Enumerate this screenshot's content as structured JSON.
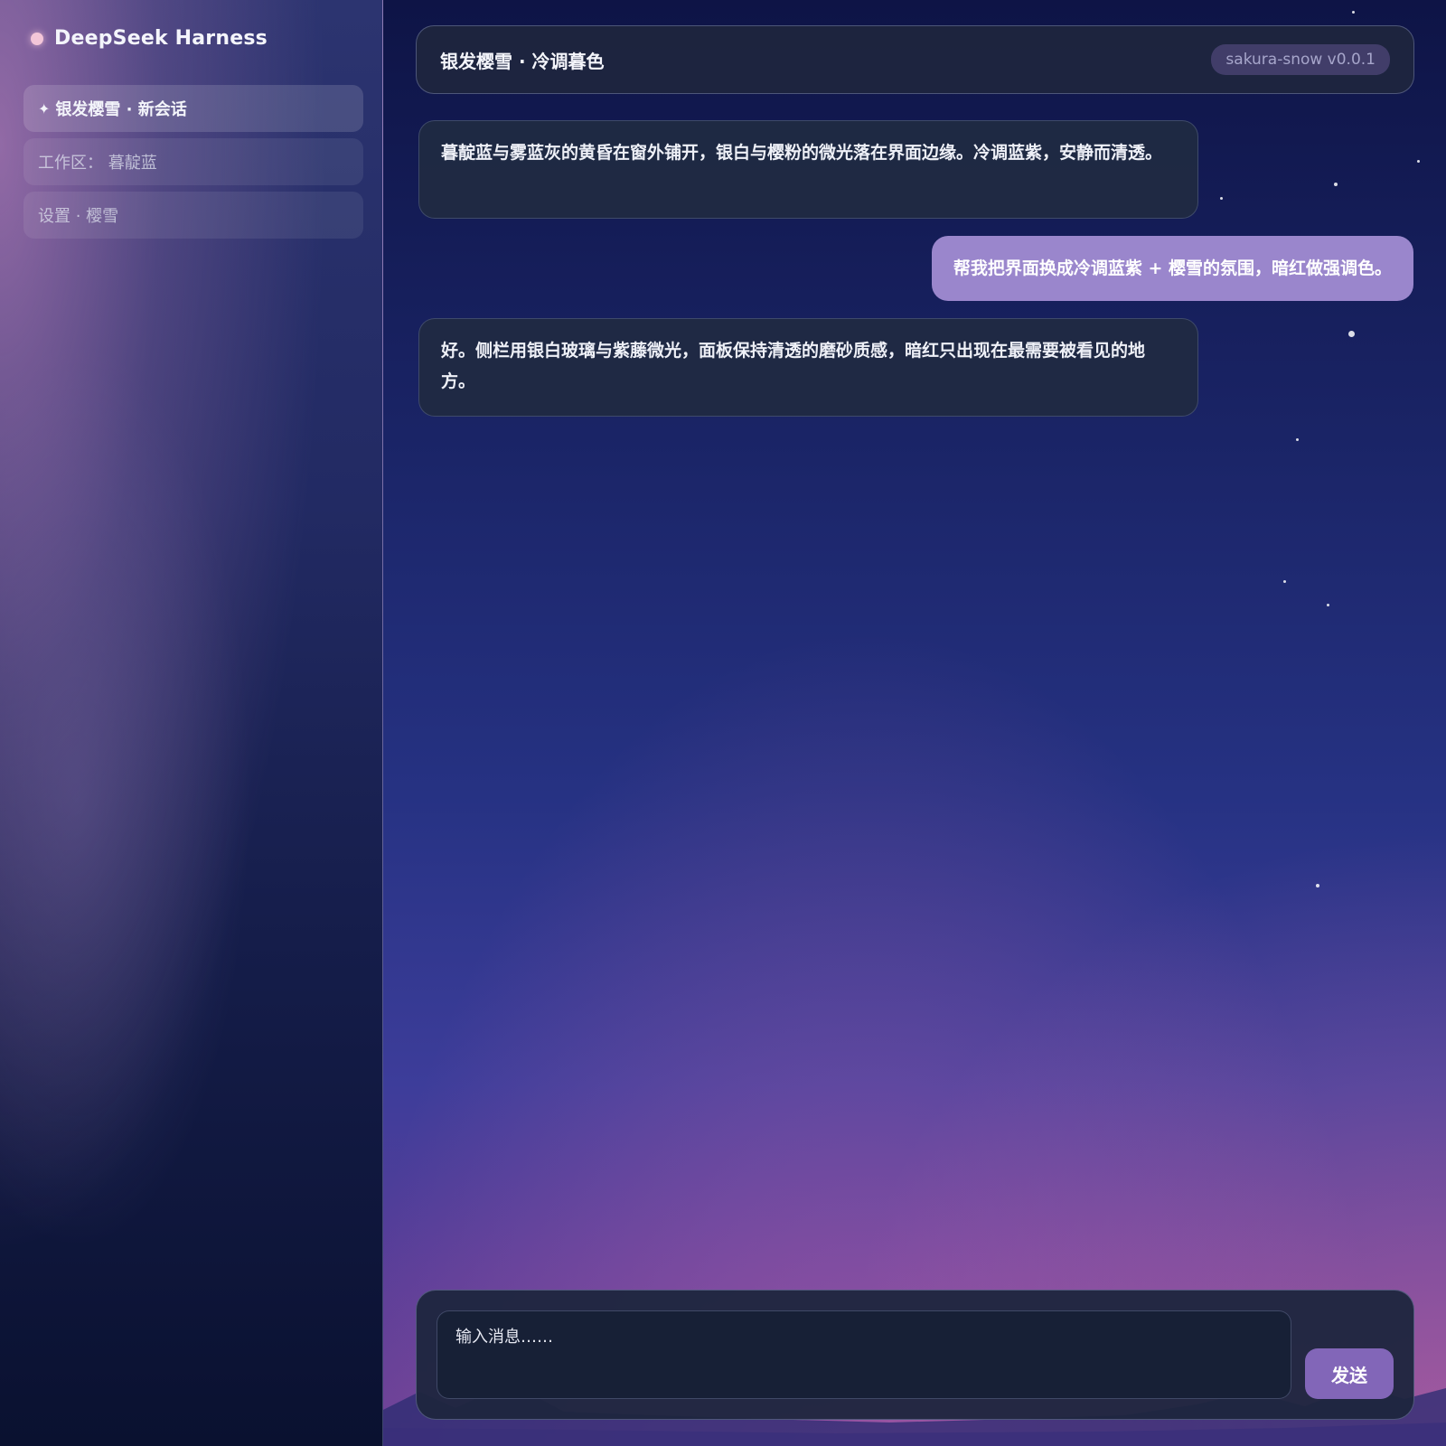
{
  "sidebar": {
    "brand_title": "DeepSeek Harness",
    "items": [
      {
        "icon": "✦",
        "label": "银发樱雪 · 新会话"
      },
      {
        "label": "工作区： 暮靛蓝"
      },
      {
        "label": "设置 · 樱雪"
      }
    ]
  },
  "header": {
    "title": "银发樱雪 · 冷调暮色",
    "version": "sakura-snow v0.0.1"
  },
  "messages": [
    {
      "role": "assistant",
      "text": "暮靛蓝与雾蓝灰的黄昏在窗外铺开，银白与樱粉的微光落在界面边缘。冷调蓝紫，安静而清透。"
    },
    {
      "role": "user",
      "text": "帮我把界面换成冷调蓝紫 + 樱雪的氛围，暗红做强调色。"
    },
    {
      "role": "assistant",
      "text": "好。侧栏用银白玻璃与紫藤微光，面板保持清透的磨砂质感，暗红只出现在最需要被看见的地方。"
    }
  ],
  "composer": {
    "placeholder": "输入消息……",
    "send_label": "发送"
  },
  "colors": {
    "accent": "#8266b8",
    "user_bubble": "#9a86cc",
    "panel": "#1e263e"
  }
}
